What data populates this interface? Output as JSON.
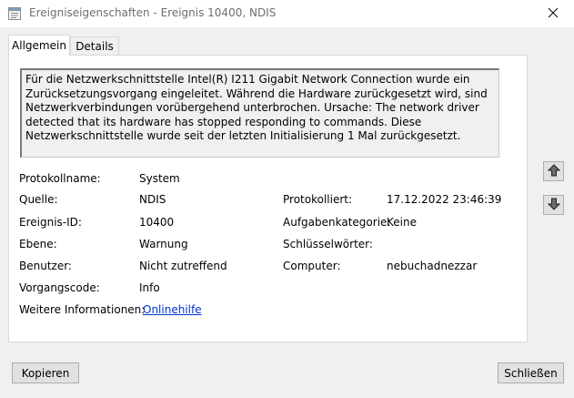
{
  "window": {
    "title": "Ereigniseigenschaften - Ereignis 10400, NDIS",
    "icon": "event-viewer-icon",
    "close_icon": "close-icon"
  },
  "tabs": [
    {
      "label": "Allgemein",
      "active": true
    },
    {
      "label": "Details",
      "active": false
    }
  ],
  "description": "Für die Netzwerkschnittstelle Intel(R) I211 Gigabit Network Connection wurde ein Zurücksetzungsvorgang eingeleitet. Während die Hardware zurückgesetzt wird, sind Netzwerkverbindungen vorübergehend unterbrochen. Ursache: The network driver detected that its hardware has stopped responding to commands. Diese Netzwerkschnittstelle wurde seit der letzten Initialisierung 1 Mal zurückgesetzt.",
  "fields": {
    "log_name": {
      "label": "Protokollname:",
      "value": "System"
    },
    "source": {
      "label": "Quelle:",
      "value": "NDIS"
    },
    "logged": {
      "label": "Protokolliert:",
      "value": "17.12.2022 23:46:39"
    },
    "event_id": {
      "label": "Ereignis-ID:",
      "value": "10400"
    },
    "task_category": {
      "label": "Aufgabenkategorie:",
      "value": "Keine"
    },
    "level": {
      "label": "Ebene:",
      "value": "Warnung"
    },
    "keywords": {
      "label": "Schlüsselwörter:",
      "value": ""
    },
    "user": {
      "label": "Benutzer:",
      "value": "Nicht zutreffend"
    },
    "computer": {
      "label": "Computer:",
      "value": "nebuchadnezzar"
    },
    "opcode": {
      "label": "Vorgangscode:",
      "value": "Info"
    },
    "more_info": {
      "label": "Weitere Informationen:",
      "value": "Onlinehilfe"
    }
  },
  "nav": {
    "up_icon": "arrow-up-icon",
    "down_icon": "arrow-down-icon"
  },
  "buttons": {
    "copy": "Kopieren",
    "close": "Schließen"
  },
  "colors": {
    "link": "#0033cc",
    "window_bg": "#f0f0f0",
    "panel_bg": "#ffffff"
  }
}
